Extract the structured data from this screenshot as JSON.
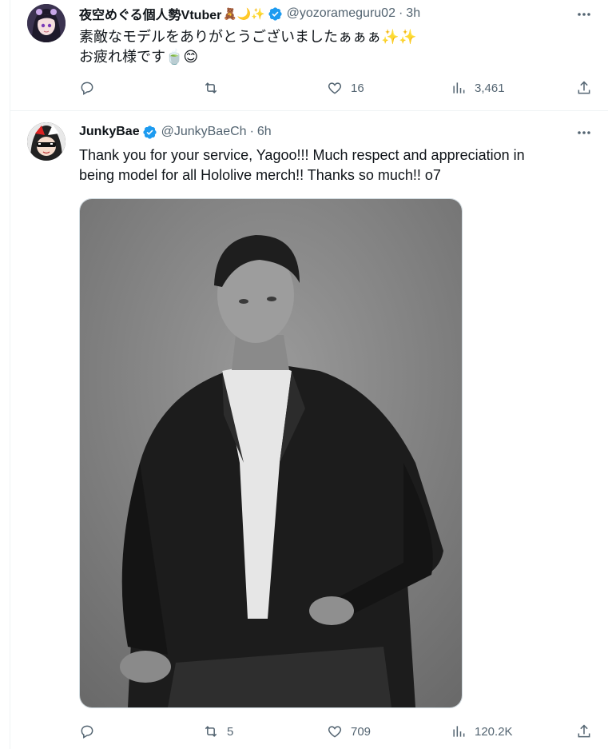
{
  "tweets": [
    {
      "author_name": "夜空めぐる個人勢Vtuber",
      "name_emoji": "🧸🌙✨",
      "handle": "@yozorameguru02",
      "separator": "·",
      "time": "3h",
      "text_line1": "素敵なモデルをありがとうございましたぁぁぁ✨✨",
      "text_line2": "お疲れ様です🍵😊",
      "verified": true,
      "avatar_icon": "anime-girl-avatar",
      "reply_count": "",
      "retweet_count": "",
      "like_count": "16",
      "view_count": "3,461"
    },
    {
      "author_name": "JunkyBae",
      "handle": "@JunkyBaeCh",
      "separator": "·",
      "time": "6h",
      "text_line1": "Thank you for your service, Yagoo!!! Much respect and appreciation in",
      "text_line2": "being model for all Hololive merch!! Thanks so much!! o7",
      "verified": true,
      "avatar_icon": "anime-character-sunglasses-avatar",
      "media_description_icon": "photo-man-in-suit",
      "reply_count": "",
      "retweet_count": "5",
      "like_count": "709",
      "view_count": "120.2K"
    }
  ],
  "colors": {
    "verified_blue": "#1d9bf0",
    "secondary_text": "#536471",
    "border": "#eff3f4"
  }
}
